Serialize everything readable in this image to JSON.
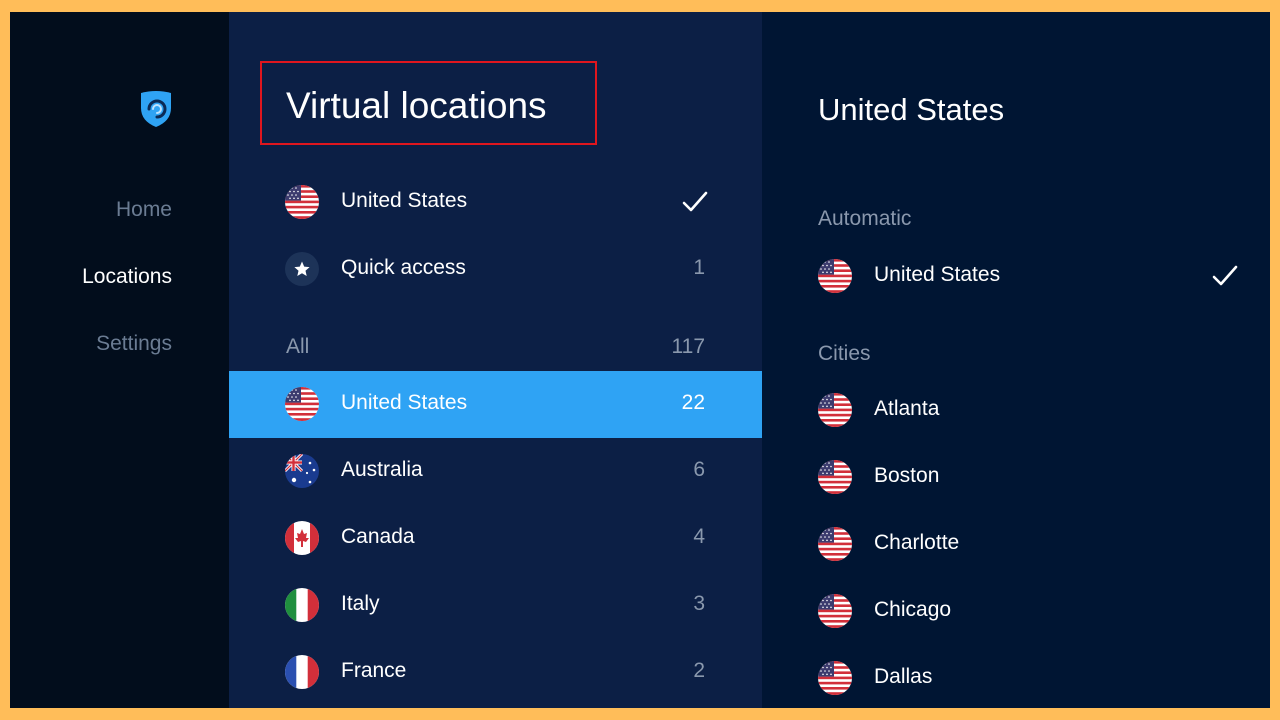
{
  "nav": {
    "items": [
      {
        "label": "Home"
      },
      {
        "label": "Locations"
      },
      {
        "label": "Settings"
      }
    ]
  },
  "locations": {
    "title": "Virtual locations",
    "current": {
      "label": "United States"
    },
    "quick_access": {
      "label": "Quick access",
      "count": "1"
    },
    "all": {
      "label": "All",
      "count": "117"
    },
    "countries": [
      {
        "label": "United States",
        "count": "22",
        "flag": "us-flag-icon"
      },
      {
        "label": "Australia",
        "count": "6",
        "flag": "australia-flag-icon"
      },
      {
        "label": "Canada",
        "count": "4",
        "flag": "canada-flag-icon"
      },
      {
        "label": "Italy",
        "count": "3",
        "flag": "italy-flag-icon"
      },
      {
        "label": "France",
        "count": "2",
        "flag": "france-flag-icon"
      }
    ]
  },
  "detail": {
    "title": "United States",
    "automatic_label": "Automatic",
    "automatic_item": "United States",
    "cities_label": "Cities",
    "cities": [
      "Atlanta",
      "Boston",
      "Charlotte",
      "Chicago",
      "Dallas"
    ]
  },
  "colors": {
    "accent": "#2fa3f4",
    "nav_bg": "#020d1c",
    "list_bg": "#0c1f45",
    "detail_bg": "#001533",
    "highlight_border": "#e0161e"
  }
}
